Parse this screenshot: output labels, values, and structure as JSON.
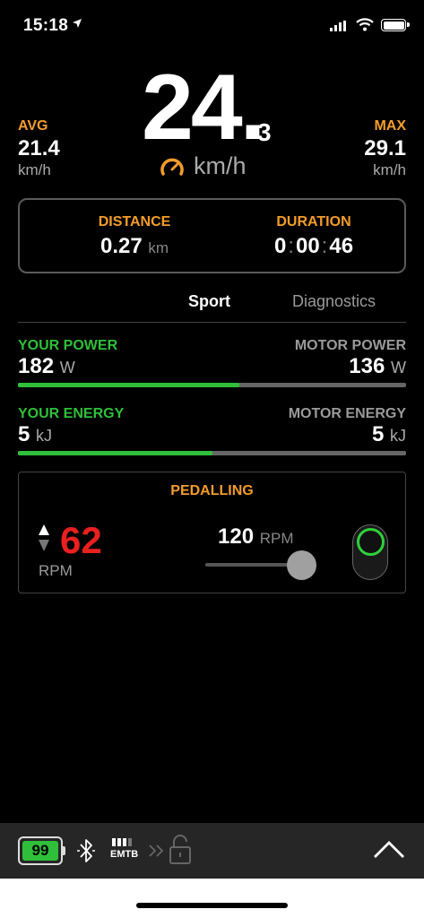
{
  "status_bar": {
    "time": "15:18"
  },
  "speed": {
    "integer": "24.",
    "decimal": "3",
    "unit": "km/h"
  },
  "avg": {
    "label": "AVG",
    "value": "21.4",
    "unit": "km/h"
  },
  "max": {
    "label": "MAX",
    "value": "29.1",
    "unit": "km/h"
  },
  "distance": {
    "label": "DISTANCE",
    "value": "0.27",
    "unit": "km"
  },
  "duration": {
    "label": "DURATION",
    "h": "0",
    "mm": "00",
    "ss": "46",
    "sep": ":"
  },
  "tabs": [
    {
      "label": "Sport",
      "active": true
    },
    {
      "label": "Diagnostics",
      "active": false
    }
  ],
  "power": {
    "left_label": "YOUR POWER",
    "left_value": "182",
    "left_unit": "W",
    "right_label": "MOTOR POWER",
    "right_value": "136",
    "right_unit": "W",
    "share": 0.57
  },
  "energy": {
    "left_label": "YOUR ENERGY",
    "left_value": "5",
    "left_unit": "kJ",
    "right_label": "MOTOR ENERGY",
    "right_value": "5",
    "right_unit": "kJ",
    "share": 0.5
  },
  "pedalling": {
    "title": "PEDALLING",
    "cadence": "62",
    "cadence_unit": "RPM",
    "target": "120",
    "target_unit": "RPM",
    "slider_level": 0.85,
    "toggle_on": true
  },
  "bottom_bar": {
    "battery_percent": "99",
    "assist_mode": "EMTB",
    "mode_level_bars": 3,
    "icons": [
      "bluetooth-icon",
      "chevrons-icon",
      "lock-icon",
      "chevron-up-icon"
    ]
  },
  "colors": {
    "accent": "#f39c2b",
    "green": "#2fbf3a",
    "red": "#e8201f",
    "background": "#000000"
  }
}
